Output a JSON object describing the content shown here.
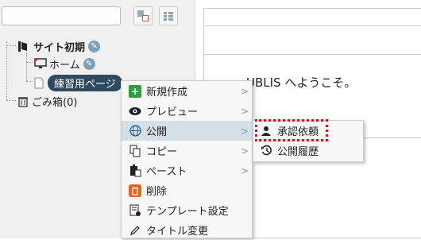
{
  "tree": {
    "root_label": "サイト初期",
    "home_label": "ホーム",
    "practice_label": "練習用ページ",
    "trash_label": "ごみ箱(0)"
  },
  "content": {
    "welcome_text": "UBLIS へようこそ。"
  },
  "context_menu": {
    "items": [
      {
        "label": "新規作成",
        "icon": "add-icon"
      },
      {
        "label": "プレビュー",
        "icon": "eye-icon"
      },
      {
        "label": "公開",
        "icon": "globe-icon"
      },
      {
        "label": "コピー",
        "icon": "copy-icon"
      },
      {
        "label": "ペースト",
        "icon": "paste-icon"
      },
      {
        "label": "削除",
        "icon": "trash-icon"
      },
      {
        "label": "テンプレート設定",
        "icon": "template-icon"
      },
      {
        "label": "タイトル変更",
        "icon": "pencil-icon"
      }
    ],
    "arrow": ">"
  },
  "submenu": {
    "items": [
      {
        "label": "承認依頼",
        "icon": "user-icon"
      },
      {
        "label": "公開履歴",
        "icon": "history-icon"
      }
    ]
  },
  "colors": {
    "highlight_border": "#d01818",
    "selected_node": "#2f4a5e",
    "menu_hover": "#d4dfe8",
    "add_green": "#2e9e3e",
    "delete_orange": "#e8641e"
  }
}
